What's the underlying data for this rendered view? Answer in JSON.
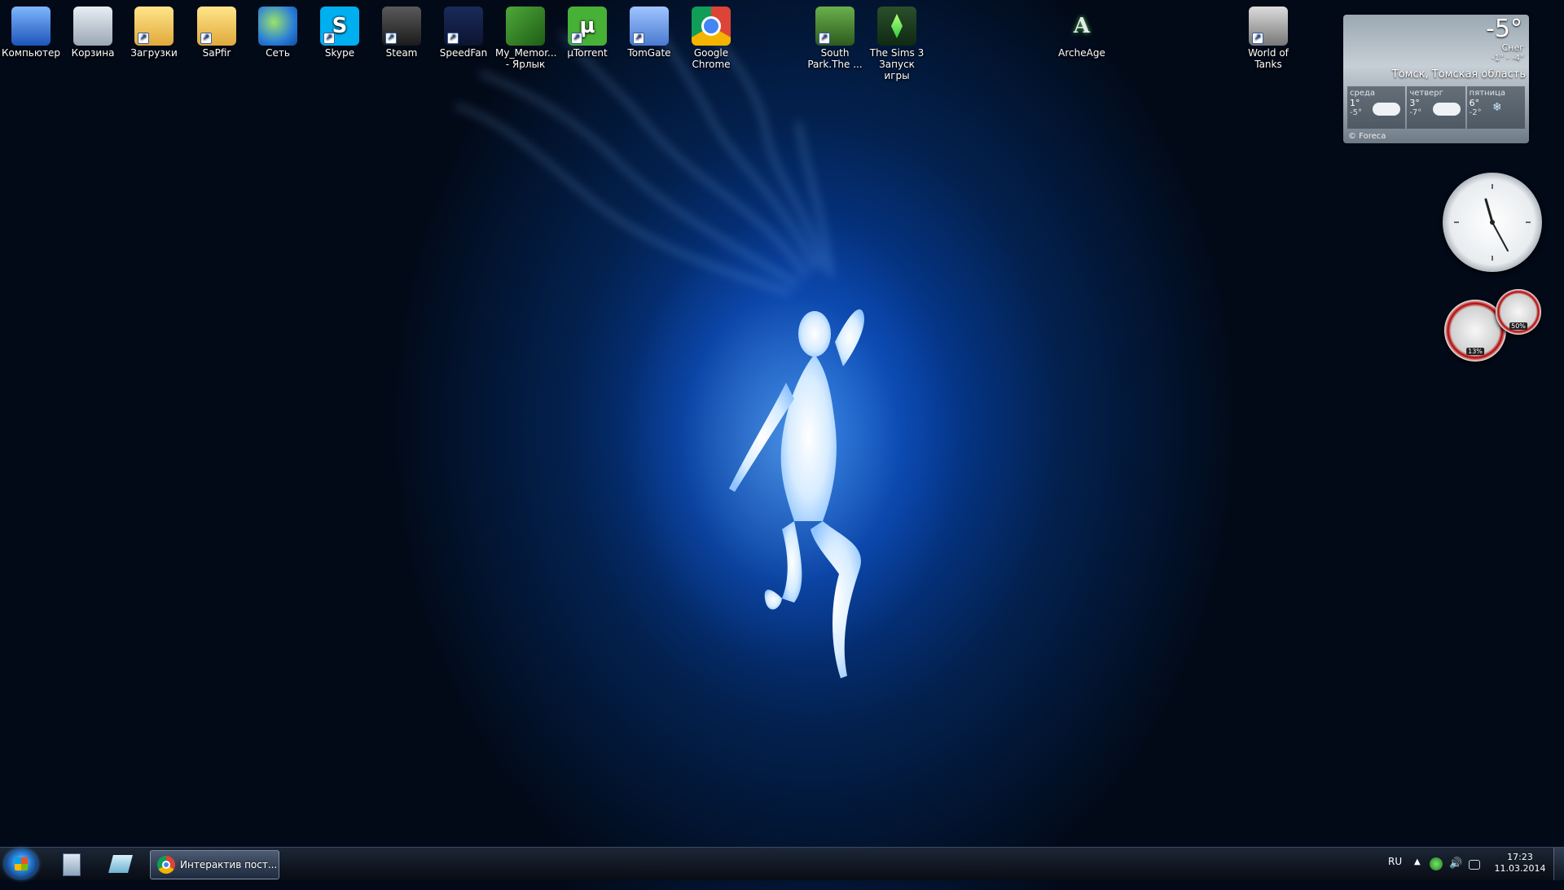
{
  "desktop_icons": [
    {
      "label": "Компьютер",
      "icon": "computer-icon"
    },
    {
      "label": "Корзина",
      "icon": "recycle-bin-icon"
    },
    {
      "label": "Загрузки",
      "icon": "downloads-folder-icon"
    },
    {
      "label": "SaPfir",
      "icon": "folder-icon"
    },
    {
      "label": "Сеть",
      "icon": "network-icon"
    },
    {
      "label": "Skype",
      "icon": "skype-icon"
    },
    {
      "label": "Steam",
      "icon": "steam-icon"
    },
    {
      "label": "SpeedFan",
      "icon": "speedfan-icon"
    },
    {
      "label": "My_Memor... - Ярлык",
      "icon": "memory-module-icon"
    },
    {
      "label": "µTorrent",
      "icon": "utorrent-icon"
    },
    {
      "label": "TomGate",
      "icon": "tomgate-icon"
    },
    {
      "label": "Google Chrome",
      "icon": "chrome-icon"
    },
    {
      "label": "South Park.The ...",
      "icon": "south-park-icon"
    },
    {
      "label": "The Sims 3 Запуск игры",
      "icon": "sims3-icon"
    },
    {
      "label": "ArcheAge",
      "icon": "archeage-icon"
    },
    {
      "label": "World of Tanks",
      "icon": "world-of-tanks-icon"
    }
  ],
  "weather": {
    "temperature": "-5°",
    "condition": "Снег",
    "range": "-1° - -4°",
    "location": "Томск, Томская область",
    "days": [
      {
        "name": "среда",
        "high": "1°",
        "low": "-5°"
      },
      {
        "name": "четверг",
        "high": "3°",
        "low": "-7°"
      },
      {
        "name": "пятница",
        "high": "6°",
        "low": "-2°"
      }
    ],
    "provider": "© Foreca"
  },
  "cpu_meter": {
    "cpu": "13%",
    "memory": "50%"
  },
  "taskbar": {
    "active_window_label": "Интерактив пост...",
    "language": "RU",
    "time": "17:23",
    "date": "11.03.2014"
  },
  "colors": {
    "wallpaper_accent": "#0b56c7",
    "taskbar": "#141c28"
  }
}
